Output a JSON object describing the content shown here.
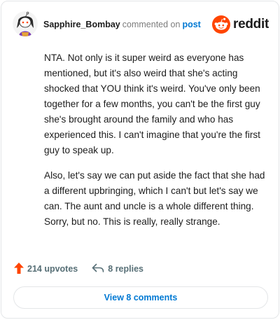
{
  "header": {
    "username": "Sapphire_Bombay",
    "action_text": "commented on",
    "post_link": "post",
    "brand": "reddit"
  },
  "comment": {
    "paragraphs": [
      "NTA. Not only is it super weird as everyone has mentioned, but it's also weird that she's acting shocked that YOU think it's weird. You've only been together for a few months, you can't be the first guy she's brought around the family and who has experienced this. I can't imagine that you're the first guy to speak up.",
      "Also, let's say we can put aside the fact that she had a different upbringing, which I can't but let's say we can. The aunt and uncle is a whole different thing. Sorry, but no. This is really, really strange."
    ]
  },
  "footer": {
    "upvotes": "214 upvotes",
    "replies": "8 replies",
    "view_button": "View 8 comments"
  },
  "colors": {
    "upvote": "#ff4500",
    "link": "#0079d3",
    "muted": "#576f76",
    "brand": "#ff4500"
  },
  "icons": {
    "avatar": "snoo-avatar",
    "brand": "reddit-logo-icon",
    "upvote": "upvote-arrow-icon",
    "reply": "reply-arrow-icon"
  }
}
